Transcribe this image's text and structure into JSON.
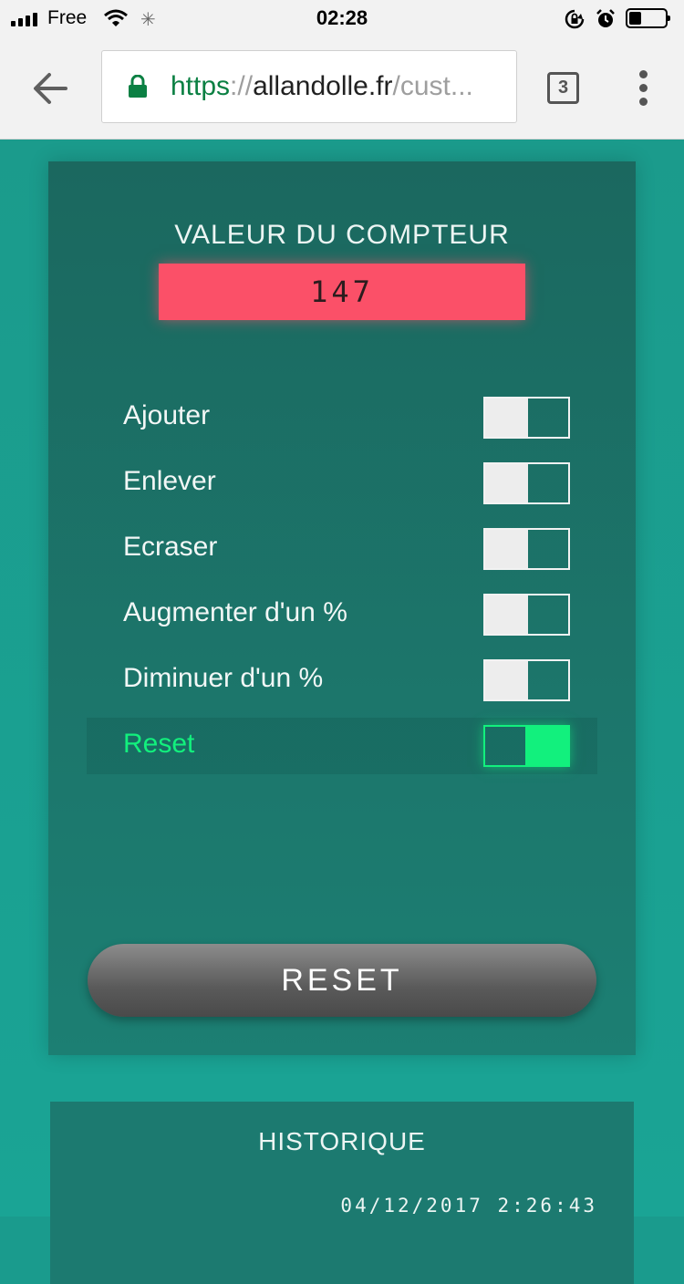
{
  "status_bar": {
    "carrier": "Free",
    "time": "02:28",
    "battery_level": 0.35
  },
  "browser": {
    "url_scheme": "https",
    "url_sep": "://",
    "url_host": "allandolle.fr",
    "url_path": "/cust...",
    "tab_count": "3"
  },
  "counter": {
    "title": "VALEUR DU COMPTEUR",
    "value": "147"
  },
  "options": [
    {
      "label": "Ajouter",
      "on": false
    },
    {
      "label": "Enlever",
      "on": false
    },
    {
      "label": "Ecraser",
      "on": false
    },
    {
      "label": "Augmenter d'un %",
      "on": false
    },
    {
      "label": "Diminuer d'un %",
      "on": false
    },
    {
      "label": "Reset",
      "on": true
    }
  ],
  "reset_button_label": "RESET",
  "history": {
    "title": "HISTORIQUE",
    "entries": [
      "04/12/2017 2:26:43"
    ]
  },
  "colors": {
    "counter_bg": "#fb5068",
    "active_green": "#12f07d",
    "page_bg": "#1a9b8d"
  }
}
